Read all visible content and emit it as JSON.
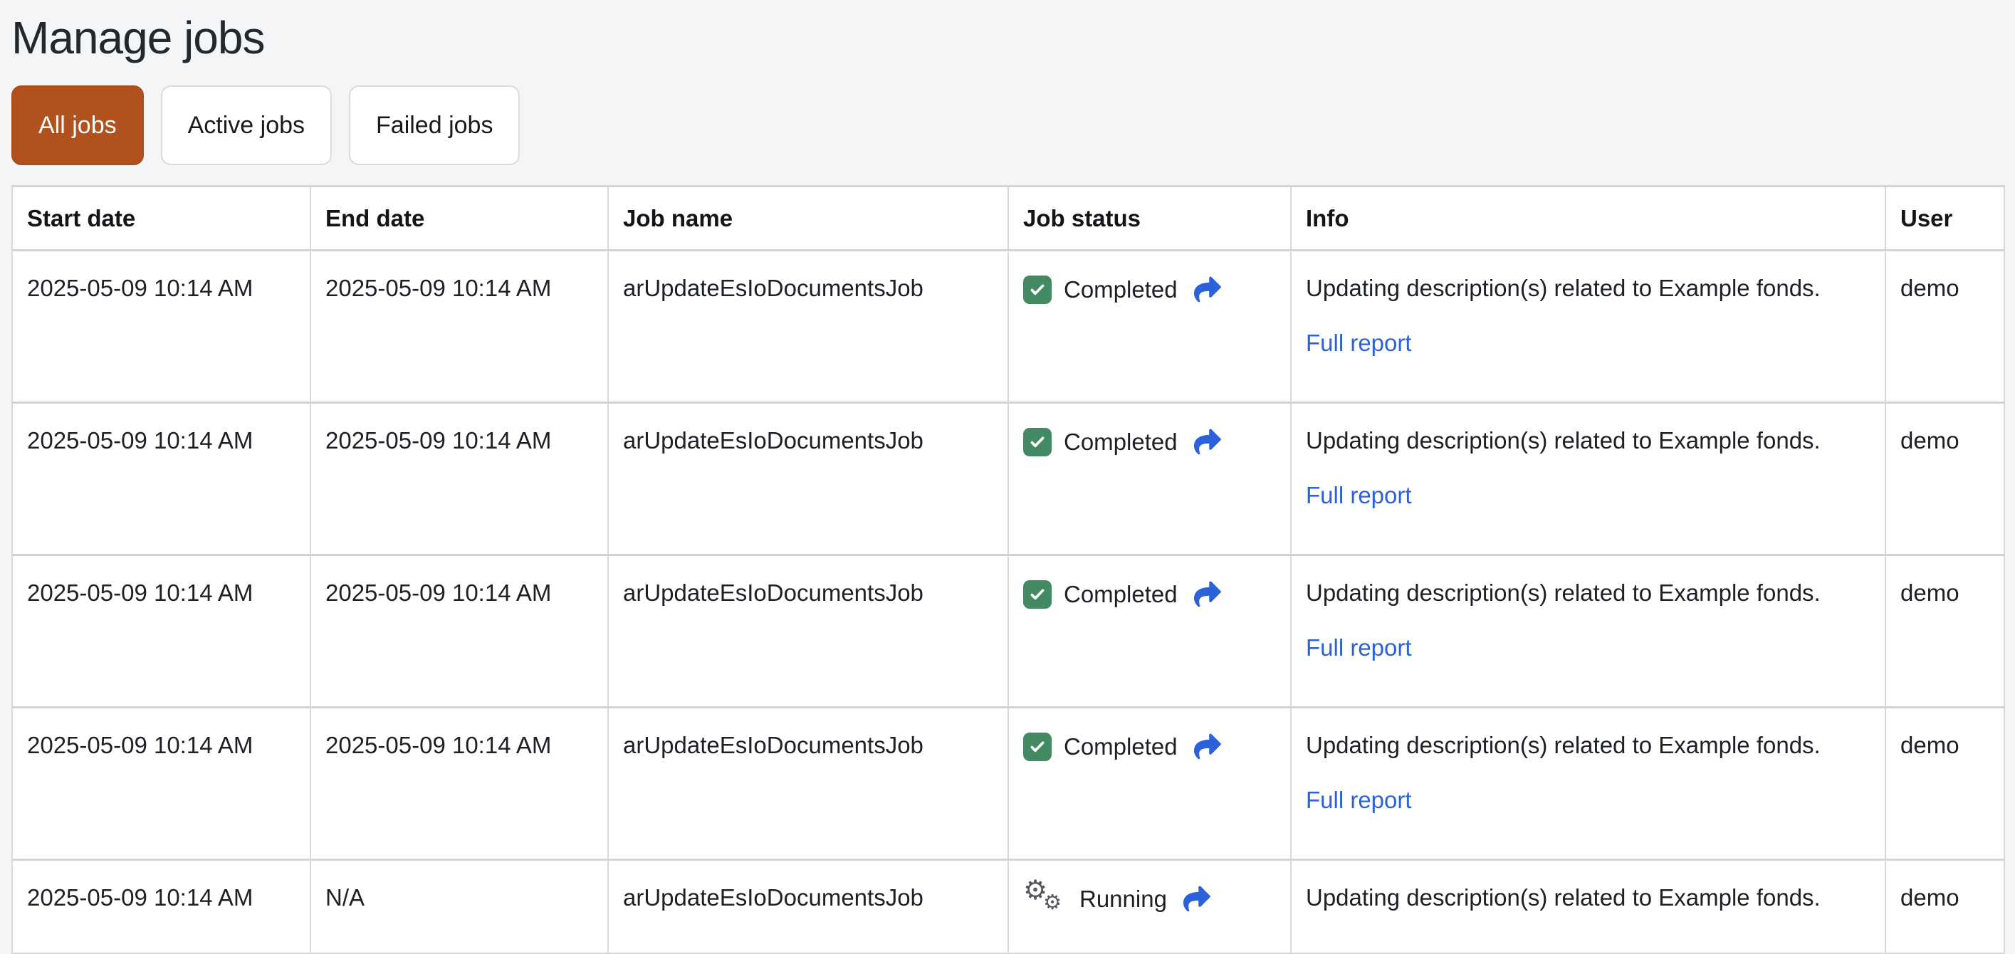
{
  "page": {
    "title": "Manage jobs"
  },
  "filters": [
    {
      "label": "All jobs",
      "active": true
    },
    {
      "label": "Active jobs",
      "active": false
    },
    {
      "label": "Failed jobs",
      "active": false
    }
  ],
  "table": {
    "columns": [
      "Start date",
      "End date",
      "Job name",
      "Job status",
      "Info",
      "User"
    ],
    "rows": [
      {
        "start_date": "2025-05-09 10:14 AM",
        "end_date": "2025-05-09 10:14 AM",
        "job_name": "arUpdateEsIoDocumentsJob",
        "status": "Completed",
        "status_icon": "check-icon",
        "share_icon": "share-icon",
        "info": "Updating description(s) related to Example fonds.",
        "report_link": "Full report",
        "user": "demo"
      },
      {
        "start_date": "2025-05-09 10:14 AM",
        "end_date": "2025-05-09 10:14 AM",
        "job_name": "arUpdateEsIoDocumentsJob",
        "status": "Completed",
        "status_icon": "check-icon",
        "share_icon": "share-icon",
        "info": "Updating description(s) related to Example fonds.",
        "report_link": "Full report",
        "user": "demo"
      },
      {
        "start_date": "2025-05-09 10:14 AM",
        "end_date": "2025-05-09 10:14 AM",
        "job_name": "arUpdateEsIoDocumentsJob",
        "status": "Completed",
        "status_icon": "check-icon",
        "share_icon": "share-icon",
        "info": "Updating description(s) related to Example fonds.",
        "report_link": "Full report",
        "user": "demo"
      },
      {
        "start_date": "2025-05-09 10:14 AM",
        "end_date": "2025-05-09 10:14 AM",
        "job_name": "arUpdateEsIoDocumentsJob",
        "status": "Completed",
        "status_icon": "check-icon",
        "share_icon": "share-icon",
        "info": "Updating description(s) related to Example fonds.",
        "report_link": "Full report",
        "user": "demo"
      },
      {
        "start_date": "2025-05-09 10:14 AM",
        "end_date": "N/A",
        "job_name": "arUpdateEsIoDocumentsJob",
        "status": "Running",
        "status_icon": "gears-icon",
        "share_icon": "share-icon",
        "info": "Updating description(s) related to Example fonds.",
        "report_link": null,
        "user": "demo"
      }
    ]
  },
  "colors": {
    "accent_orange": "#b1521e",
    "success_green": "#438a63",
    "link_blue": "#2b62d9",
    "gear_gray": "#54585e",
    "page_background": "#f4f5f6",
    "table_border": "#d7dadd"
  }
}
